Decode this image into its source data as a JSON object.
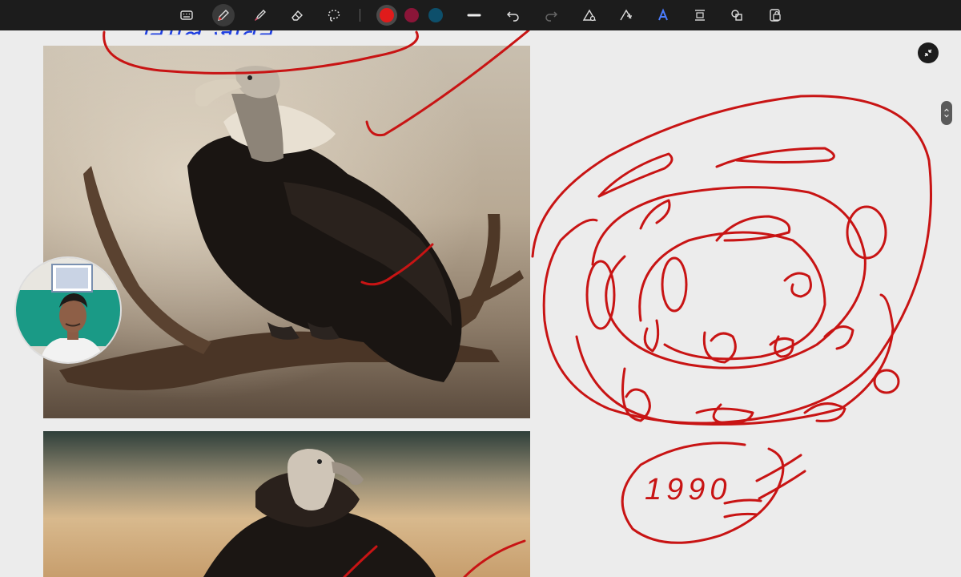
{
  "toolbar": {
    "tools": [
      {
        "name": "keyboard-icon",
        "label": "Keyboard"
      },
      {
        "name": "pen-icon",
        "label": "Pen",
        "active": true
      },
      {
        "name": "highlighter-icon",
        "label": "Highlighter"
      },
      {
        "name": "eraser-icon",
        "label": "Eraser"
      },
      {
        "name": "lasso-icon",
        "label": "Lasso select"
      }
    ],
    "colors": [
      {
        "name": "red",
        "hex": "#e01b1b",
        "active": true
      },
      {
        "name": "maroon",
        "hex": "#8a1538"
      },
      {
        "name": "teal",
        "hex": "#0d4f6b"
      }
    ],
    "actions": [
      {
        "name": "stroke-width-icon"
      },
      {
        "name": "undo-icon"
      },
      {
        "name": "redo-icon",
        "disabled": true
      },
      {
        "name": "ruler-icon"
      },
      {
        "name": "shape-icon"
      },
      {
        "name": "text-ink-icon"
      },
      {
        "name": "space-icon"
      },
      {
        "name": "shapes-icon"
      },
      {
        "name": "lock-icon"
      }
    ]
  },
  "canvas": {
    "ink_color": "#c81414",
    "handwritten_heading": "निर्मल जीवन",
    "handwritten_number": "1990",
    "images": [
      {
        "name": "vulture-on-branch-image",
        "subject": "vulture perched on dead branch"
      },
      {
        "name": "vulture-portrait-image",
        "subject": "vulture close-up"
      }
    ]
  },
  "colors": {
    "toolbar_bg": "#1c1c1c",
    "canvas_bg": "#ececec",
    "ink_red": "#c81414",
    "ink_blue": "#2040e0"
  }
}
